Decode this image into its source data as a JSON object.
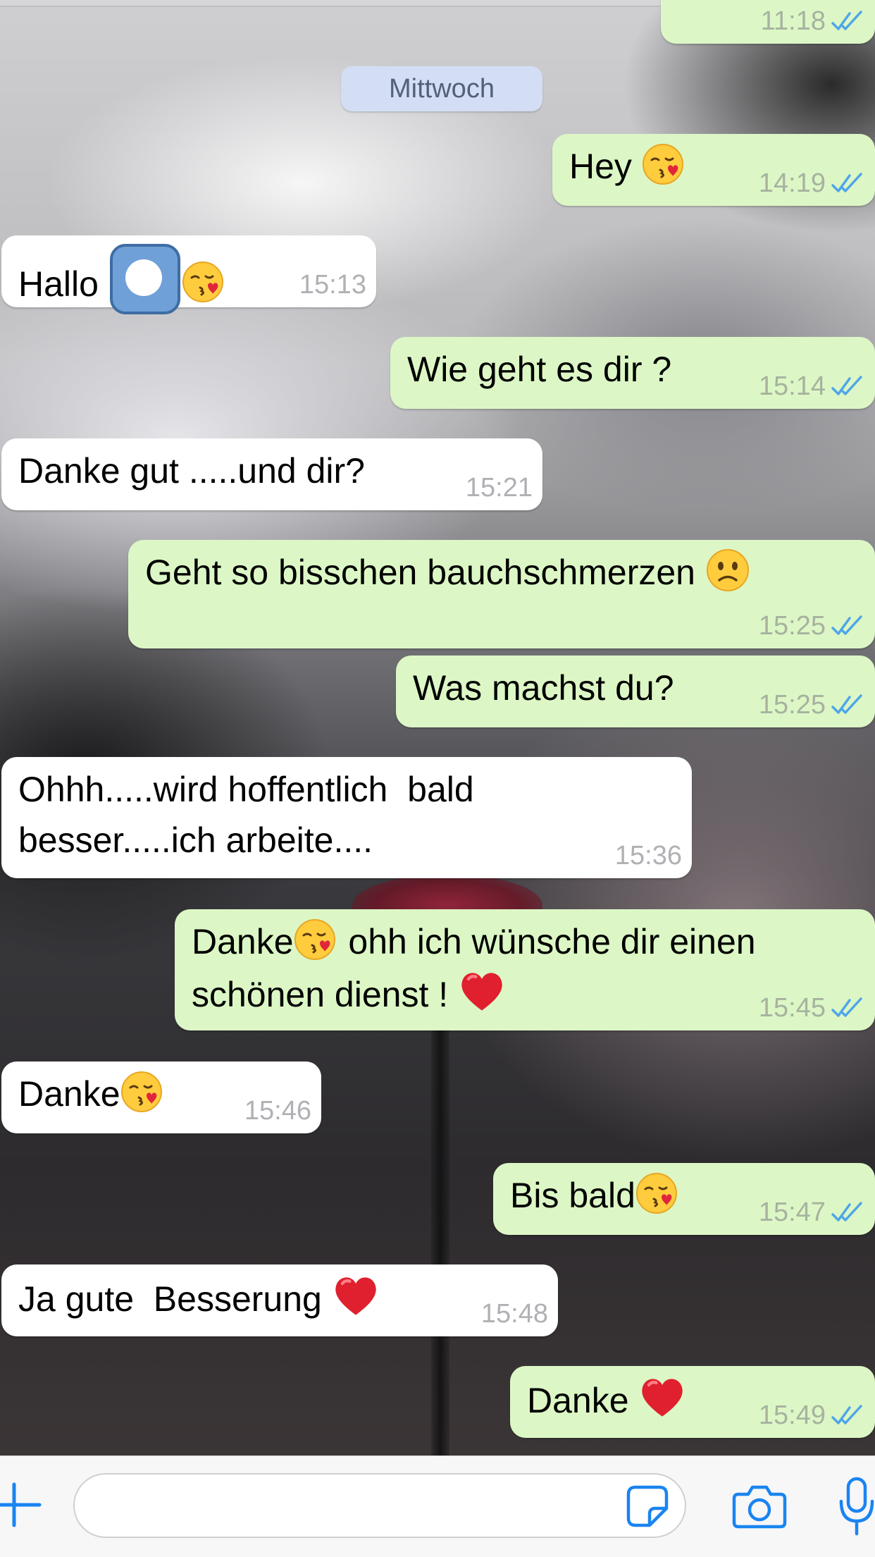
{
  "chat": {
    "date_separator": "Mittwoch",
    "messages": [
      {
        "direction": "out",
        "text": "",
        "time": "11:18",
        "status": "read"
      },
      {
        "direction": "out",
        "text": "Hey",
        "emoji": "kissing-heart",
        "time": "14:19",
        "status": "read"
      },
      {
        "direction": "in",
        "text": "Hallo",
        "emoji": "record-button kissing-heart",
        "time": "15:13"
      },
      {
        "direction": "out",
        "text": "Wie geht es dir ?",
        "time": "15:14",
        "status": "read"
      },
      {
        "direction": "in",
        "text": "Danke gut .....und dir?",
        "time": "15:21"
      },
      {
        "direction": "out",
        "text": "Geht so bisschen bauchschmerzen",
        "emoji": "slightly-frowning-face",
        "time": "15:25",
        "status": "read"
      },
      {
        "direction": "out",
        "text": "Was machst du?",
        "time": "15:25",
        "status": "read"
      },
      {
        "direction": "in",
        "text": "Ohhh.....wird hoffentlich  bald besser.....ich arbeite....",
        "time": "15:36"
      },
      {
        "direction": "out",
        "text_part1": "Danke",
        "text_part2": " ohh ich wünsche dir einen schönen dienst !",
        "emoji": "kissing-heart red-heart",
        "time": "15:45",
        "status": "read"
      },
      {
        "direction": "in",
        "text": "Danke",
        "emoji": "kissing-heart",
        "time": "15:46"
      },
      {
        "direction": "out",
        "text": "Bis bald",
        "emoji": "kissing-heart",
        "time": "15:47",
        "status": "read"
      },
      {
        "direction": "in",
        "text": "Ja gute  Besserung",
        "emoji": "red-heart",
        "time": "15:48"
      },
      {
        "direction": "out",
        "text": "Danke",
        "emoji": "red-heart",
        "time": "15:49",
        "status": "read"
      }
    ]
  },
  "input_bar": {
    "message_placeholder": "",
    "icons": [
      "plus-icon",
      "sticker-icon",
      "camera-icon",
      "microphone-icon"
    ]
  },
  "colors": {
    "outgoing_bubble": "#dcf7c5",
    "incoming_bubble": "#ffffff",
    "read_ticks": "#4fa6e8",
    "accent": "#1a84f0",
    "date_chip": "#d3def4"
  }
}
